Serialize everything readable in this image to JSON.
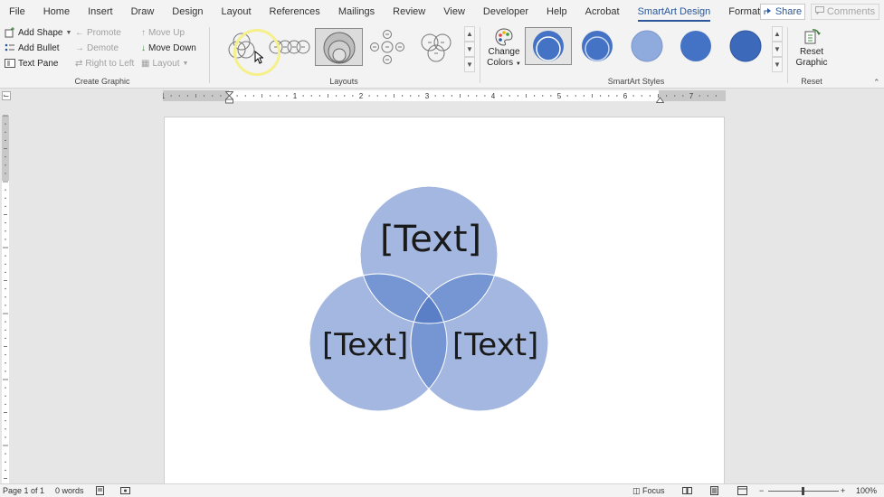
{
  "tabs": [
    {
      "label": "File"
    },
    {
      "label": "Home"
    },
    {
      "label": "Insert"
    },
    {
      "label": "Draw"
    },
    {
      "label": "Design"
    },
    {
      "label": "Layout"
    },
    {
      "label": "References"
    },
    {
      "label": "Mailings"
    },
    {
      "label": "Review"
    },
    {
      "label": "View"
    },
    {
      "label": "Developer"
    },
    {
      "label": "Help"
    },
    {
      "label": "Acrobat"
    },
    {
      "label": "SmartArt Design",
      "active": true
    },
    {
      "label": "Format"
    }
  ],
  "share_label": "Share",
  "comments_label": "Comments",
  "create_graphic": {
    "label": "Create Graphic",
    "add_shape": "Add Shape",
    "add_bullet": "Add Bullet",
    "text_pane": "Text Pane",
    "promote": "Promote",
    "demote": "Demote",
    "right_to_left": "Right to Left",
    "move_up": "Move Up",
    "move_down": "Move Down",
    "layout": "Layout"
  },
  "layouts_label": "Layouts",
  "change_colors": {
    "line1": "Change",
    "line2": "Colors"
  },
  "smartart_styles_label": "SmartArt Styles",
  "reset": {
    "line1": "Reset",
    "line2": "Graphic",
    "group_label": "Reset"
  },
  "venn": {
    "top": "[Text]",
    "left": "[Text]",
    "right": "[Text]"
  },
  "ruler_numbers": [
    "1",
    "1",
    "2",
    "3",
    "4",
    "5",
    "6",
    "7"
  ],
  "status": {
    "page": "Page 1 of 1",
    "words": "0 words",
    "focus": "Focus",
    "zoom": "100%"
  },
  "colors": {
    "accent": "#2b579a",
    "circle_fill": "#8faadc",
    "circle_overlap": "#5b7fc6",
    "highlight_ring": "#f5f08a"
  }
}
